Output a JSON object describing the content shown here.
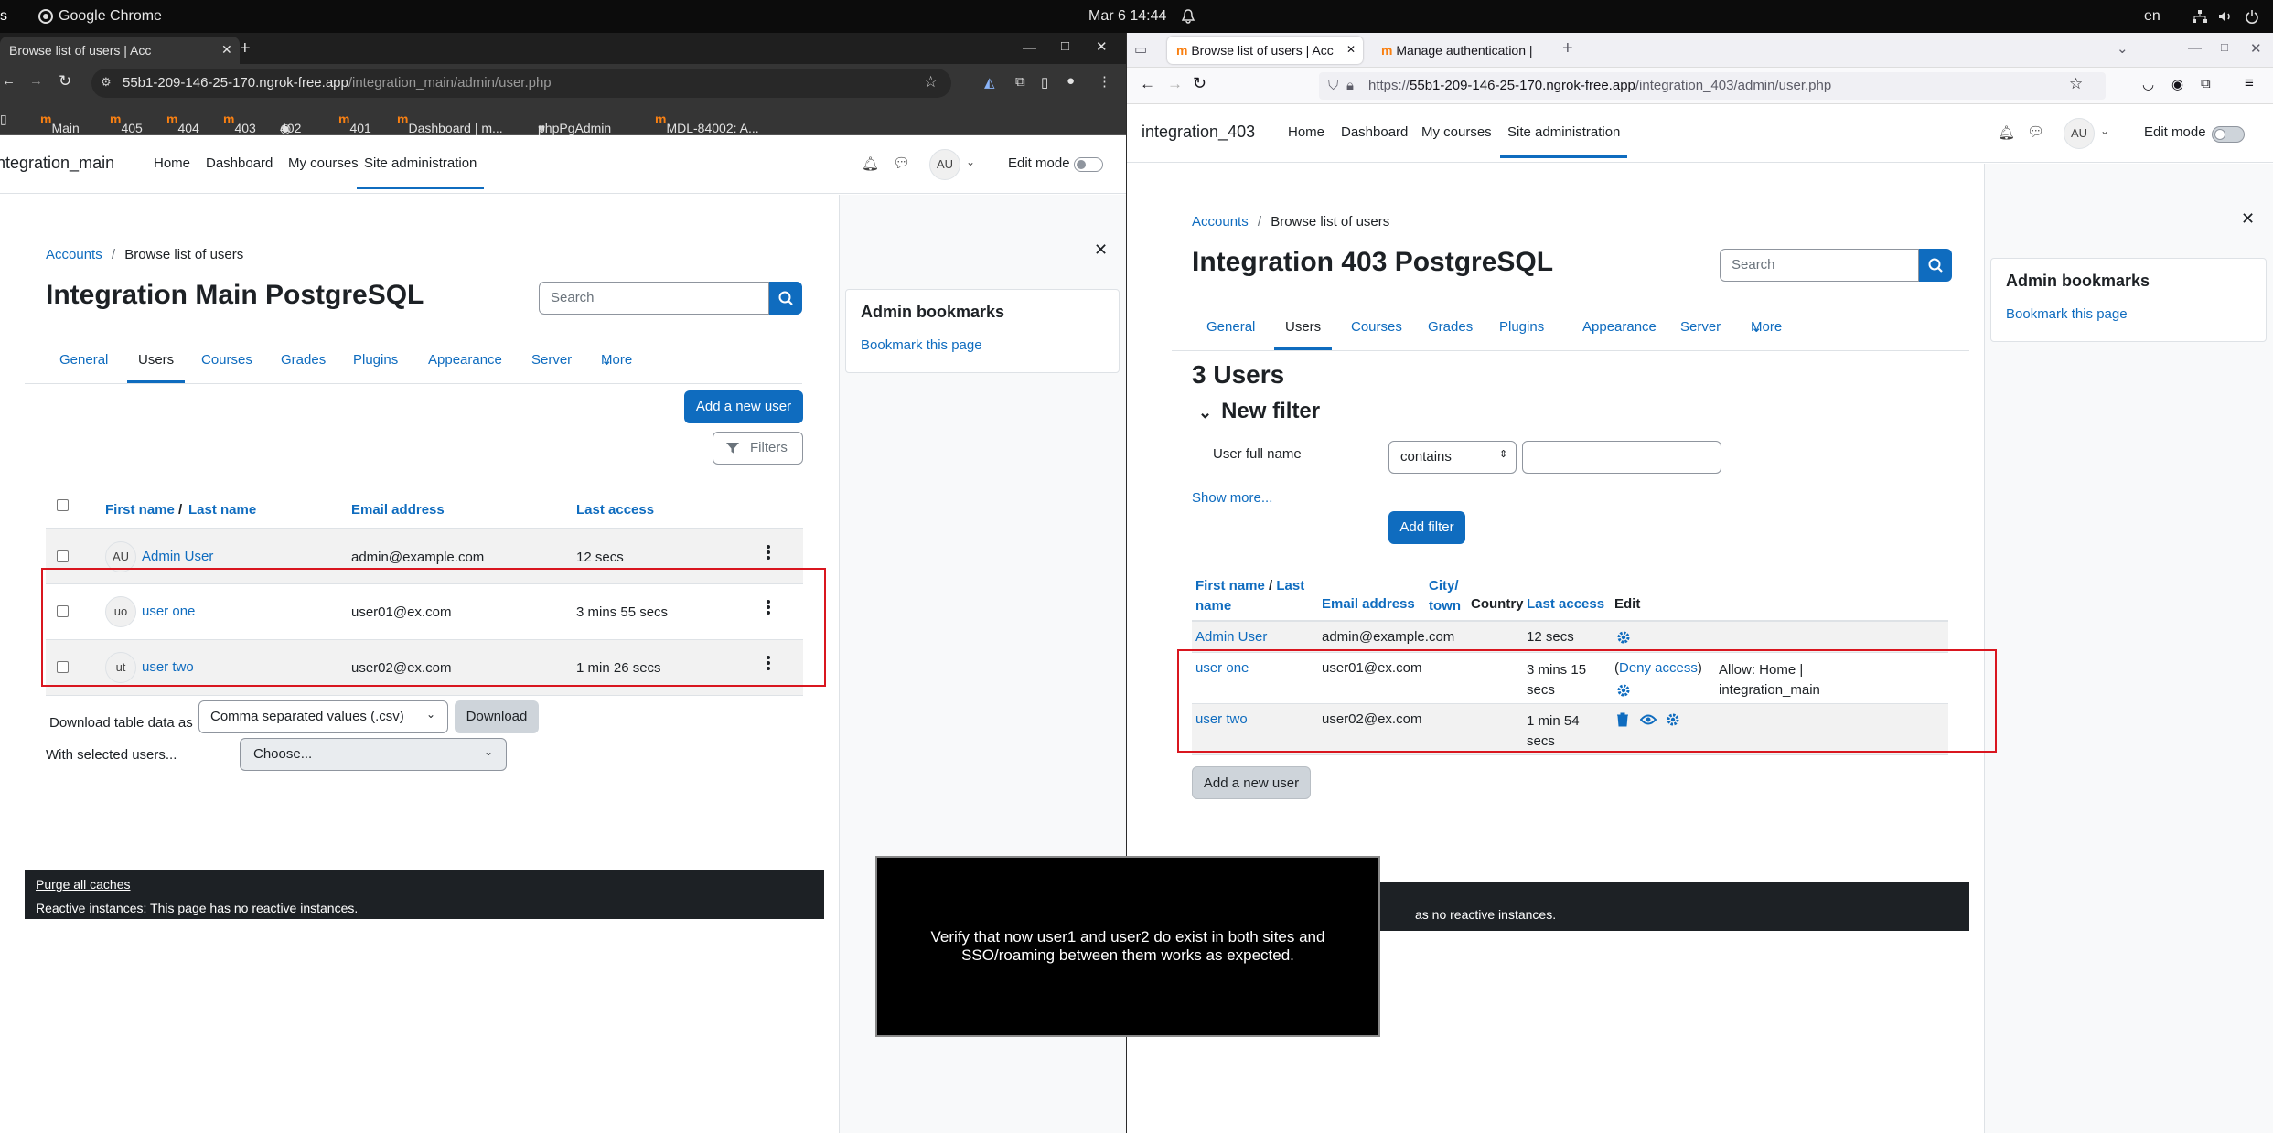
{
  "topbar": {
    "app": "Google Chrome",
    "datetime": "Mar 6  14:44",
    "lang": "en"
  },
  "chrome": {
    "tab_title": "Browse list of users | Acc",
    "url_host": "55b1-209-146-25-170.ngrok-free.app",
    "url_path": "/integration_main/admin/user.php",
    "bookmarks": [
      "Main",
      "405",
      "404",
      "403",
      "402",
      "401",
      "Dashboard | m...",
      "phpPgAdmin",
      "MDL-84002: A..."
    ],
    "site_name": "integration_main",
    "nav": [
      "Home",
      "Dashboard",
      "My courses",
      "Site administration"
    ],
    "avatar": "AU",
    "edit_mode": "Edit mode",
    "breadcrumb": {
      "parent": "Accounts",
      "sep": "/",
      "current": "Browse list of users"
    },
    "page_title": "Integration Main PostgreSQL",
    "search_placeholder": "Search",
    "tabs": [
      "General",
      "Users",
      "Courses",
      "Grades",
      "Plugins",
      "Appearance",
      "Server",
      "More"
    ],
    "add_user": "Add a new user",
    "filters": "Filters",
    "columns": {
      "first": "First name",
      "slash": " / ",
      "last": "Last name",
      "email": "Email address",
      "access": "Last access"
    },
    "rows": [
      {
        "initials": "AU",
        "name": "Admin User",
        "email": "admin@example.com",
        "access": "12 secs"
      },
      {
        "initials": "uo",
        "name": "user one",
        "email": "user01@ex.com",
        "access": "3 mins 55 secs"
      },
      {
        "initials": "ut",
        "name": "user two",
        "email": "user02@ex.com",
        "access": "1 min 26 secs"
      }
    ],
    "download_label": "Download table data as",
    "download_format": "Comma separated values (.csv)",
    "download_button": "Download",
    "with_selected": "With selected users...",
    "choose": "Choose...",
    "bookmarks_drawer": {
      "title": "Admin bookmarks",
      "link": "Bookmark this page"
    },
    "footer": {
      "purge": "Purge all caches",
      "reactive": "Reactive instances: This page has no reactive instances."
    }
  },
  "firefox": {
    "tab1": "Browse list of users | Acc",
    "tab2": "Manage authentication |",
    "url_prefix": "https://",
    "url_host": "55b1-209-146-25-170.ngrok-free.app",
    "url_path": "/integration_403/admin/user.php",
    "site_name": "integration_403",
    "nav": [
      "Home",
      "Dashboard",
      "My courses",
      "Site administration"
    ],
    "avatar": "AU",
    "edit_mode": "Edit mode",
    "breadcrumb": {
      "parent": "Accounts",
      "sep": "/",
      "current": "Browse list of users"
    },
    "page_title": "Integration 403 PostgreSQL",
    "search_placeholder": "Search",
    "tabs": [
      "General",
      "Users",
      "Courses",
      "Grades",
      "Plugins",
      "Appearance",
      "Server",
      "More"
    ],
    "users_count": "3 Users",
    "new_filter": "New filter",
    "filter_label": "User full name",
    "filter_op": "contains",
    "show_more": "Show more...",
    "add_filter": "Add filter",
    "columns": {
      "first": "First name",
      "slash": " / ",
      "last_1": "Last",
      "last_2": "name",
      "email": "Email address",
      "city_1": "City/",
      "city_2": "town",
      "country": "Country",
      "access": "Last access",
      "edit": "Edit"
    },
    "rows": [
      {
        "name": "Admin User",
        "email": "admin@example.com",
        "access": "12 secs"
      },
      {
        "name": "user one",
        "email": "user01@ex.com",
        "access_1": "3 mins 15",
        "access_2": "secs",
        "deny_open": "(",
        "deny": "Deny access",
        "deny_close": ")",
        "allow_1": "Allow: Home |",
        "allow_2": "integration_main"
      },
      {
        "name": "user two",
        "email": "user02@ex.com",
        "access_1": "1 min 54",
        "access_2": "secs"
      }
    ],
    "add_user": "Add a new user",
    "bookmarks_drawer": {
      "title": "Admin bookmarks",
      "link": "Bookmark this page"
    },
    "footer_partial": "as no reactive instances."
  },
  "overlay": {
    "text": "Verify that now user1 and user2 do exist in both sites and SSO/roaming between them works as expected."
  },
  "colors": {
    "primary": "#0f6cbf",
    "highlight": "#d9161f",
    "footer": "#1d2125"
  }
}
